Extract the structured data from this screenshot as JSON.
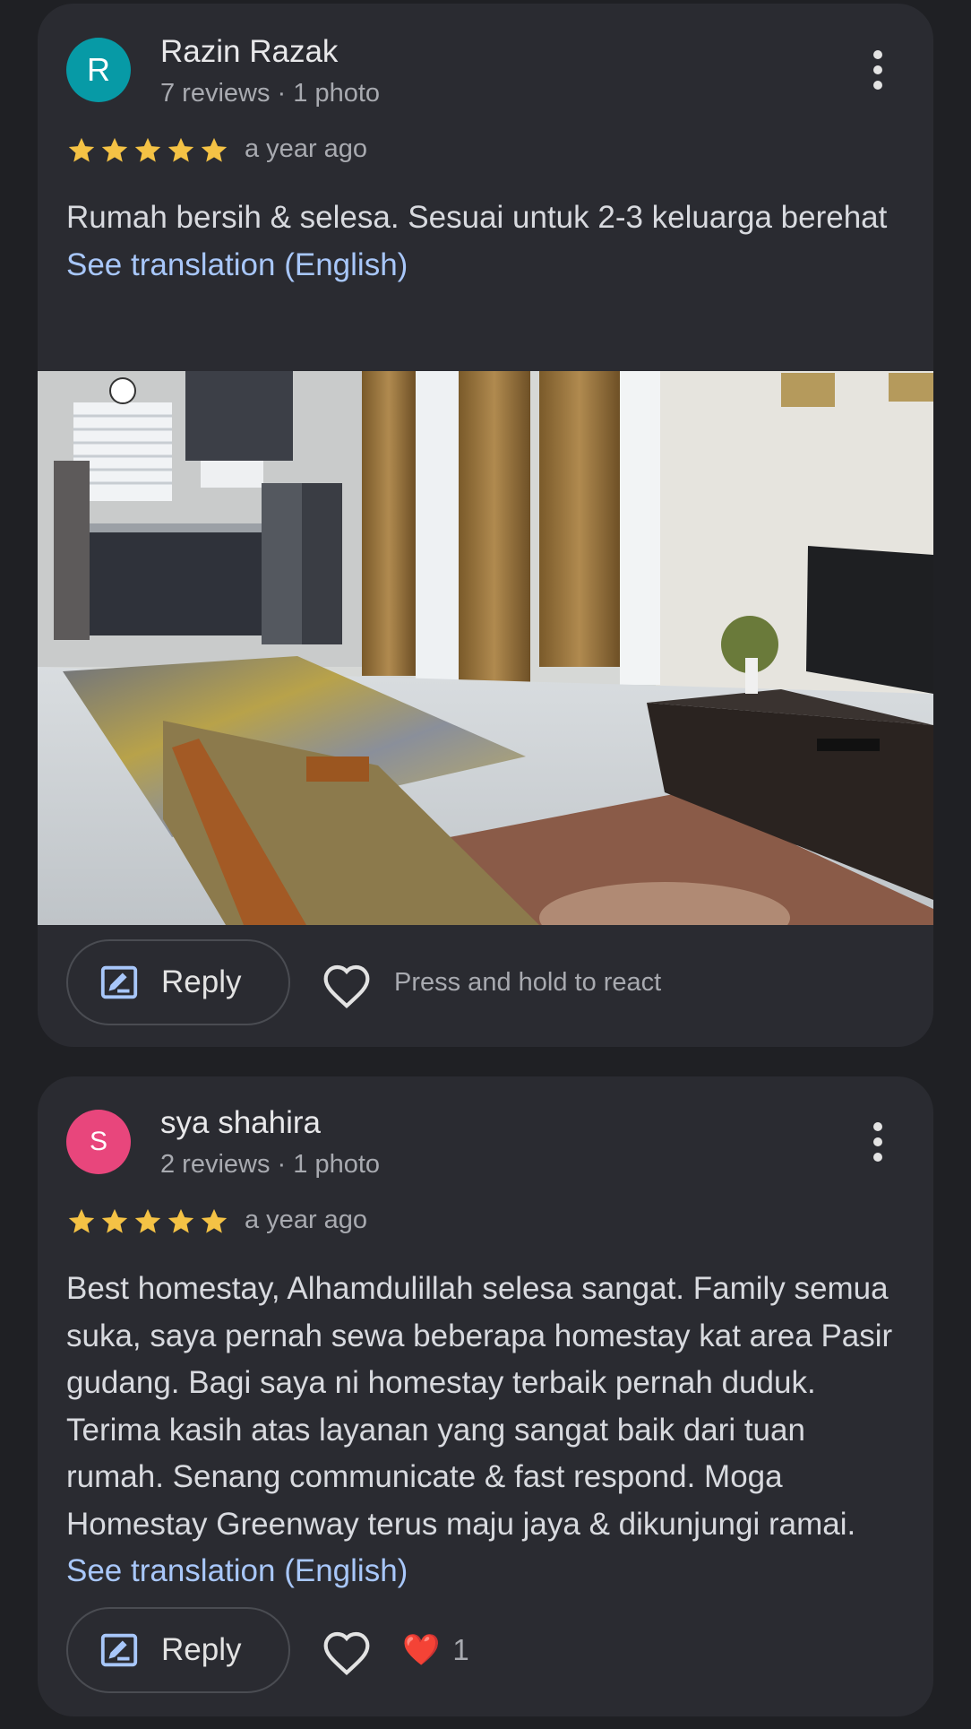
{
  "colors": {
    "star": "#f4c245",
    "link": "#a8c7fa",
    "card": "#2a2b31",
    "background": "#1f2024"
  },
  "reviews": [
    {
      "avatar_letter": "R",
      "avatar_color": "#079aa6",
      "name": "Razin Razak",
      "meta": "7 reviews · 1 photo",
      "rating": 5,
      "time": "a year ago",
      "text": "Rumah bersih & selesa. Sesuai untuk 2-3 keluarga berehat",
      "translate_label": "See translation (English)",
      "has_photo": true,
      "reply_label": "Reply",
      "react_hint": "Press and hold to react"
    },
    {
      "avatar_letter": "S",
      "avatar_color": "#e8467c",
      "name": "sya shahira",
      "meta": "2 reviews · 1 photo",
      "rating": 5,
      "time": "a year ago",
      "text": "Best homestay, Alhamdulillah selesa sangat. Family semua suka, saya pernah sewa beberapa homestay kat area Pasir gudang. Bagi saya ni homestay terbaik pernah duduk. Terima kasih atas layanan yang sangat baik dari tuan rumah. Senang communicate & fast respond. Moga Homestay Greenway terus maju jaya & dikunjungi ramai.",
      "translate_label": "See translation (English)",
      "has_photo": false,
      "reply_label": "Reply",
      "reaction_emoji": "❤️",
      "reaction_count": "1"
    }
  ]
}
